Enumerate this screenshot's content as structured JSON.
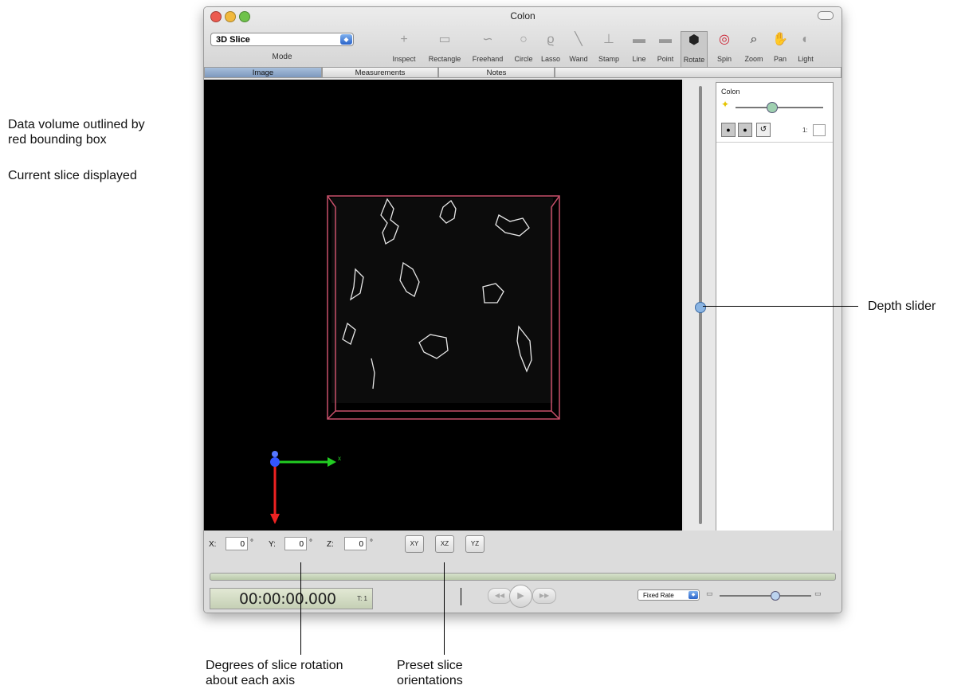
{
  "annotations": {
    "bounding_box_line1": "Data volume outlined by",
    "bounding_box_line2": "red bounding box",
    "current_slice": "Current slice displayed",
    "depth_slider": "Depth slider",
    "rotation_line1": "Degrees of slice rotation",
    "rotation_line2": "about each axis",
    "preset_line1": "Preset slice",
    "preset_line2": "orientations"
  },
  "window": {
    "title": "Colon"
  },
  "mode": {
    "value": "3D Slice",
    "label": "Mode"
  },
  "toolbar": {
    "tools": [
      {
        "name": "inspect",
        "label": "Inspect",
        "icon": "crosshair-icon"
      },
      {
        "name": "rectangle",
        "label": "Rectangle",
        "icon": "rectangle-icon"
      },
      {
        "name": "freehand",
        "label": "Freehand",
        "icon": "freehand-icon"
      },
      {
        "name": "circle",
        "label": "Circle",
        "icon": "circle-icon"
      },
      {
        "name": "lasso",
        "label": "Lasso",
        "icon": "lasso-icon"
      },
      {
        "name": "wand",
        "label": "Wand",
        "icon": "wand-icon"
      },
      {
        "name": "stamp",
        "label": "Stamp",
        "icon": "stamp-icon"
      },
      {
        "name": "line",
        "label": "Line",
        "icon": "line-icon"
      },
      {
        "name": "point",
        "label": "Point",
        "icon": "point-icon"
      },
      {
        "name": "rotate",
        "label": "Rotate",
        "icon": "cube-icon"
      },
      {
        "name": "spin",
        "label": "Spin",
        "icon": "spin-icon"
      },
      {
        "name": "zoom",
        "label": "Zoom",
        "icon": "magnifier-icon"
      },
      {
        "name": "pan",
        "label": "Pan",
        "icon": "hand-icon"
      },
      {
        "name": "light",
        "label": "Light",
        "icon": "light-icon"
      }
    ]
  },
  "tabs": [
    {
      "label": "Image",
      "active": true
    },
    {
      "label": "Measurements",
      "active": false
    },
    {
      "label": "Notes",
      "active": false
    }
  ],
  "panel": {
    "title": "Colon",
    "t_field": "1:"
  },
  "viewer": {
    "depth_slider_level": 0.5
  },
  "rotation": {
    "x_label": "X:",
    "x_value": "0",
    "y_label": "Y:",
    "y_value": "0",
    "z_label": "Z:",
    "z_value": "0",
    "degree_symbol": "°"
  },
  "presets": {
    "xy": "XY",
    "xz": "XZ",
    "yz": "YZ"
  },
  "timeline": {
    "timecode": "00:00:00.000",
    "t_label": "T: 1",
    "rate": "Fixed Rate"
  },
  "colors": {
    "bounding_box": "#c8506a",
    "x_axis": "#22cc22",
    "y_axis": "#ee2222",
    "z_axis": "#3355ff",
    "accent": "#2a63c9"
  }
}
